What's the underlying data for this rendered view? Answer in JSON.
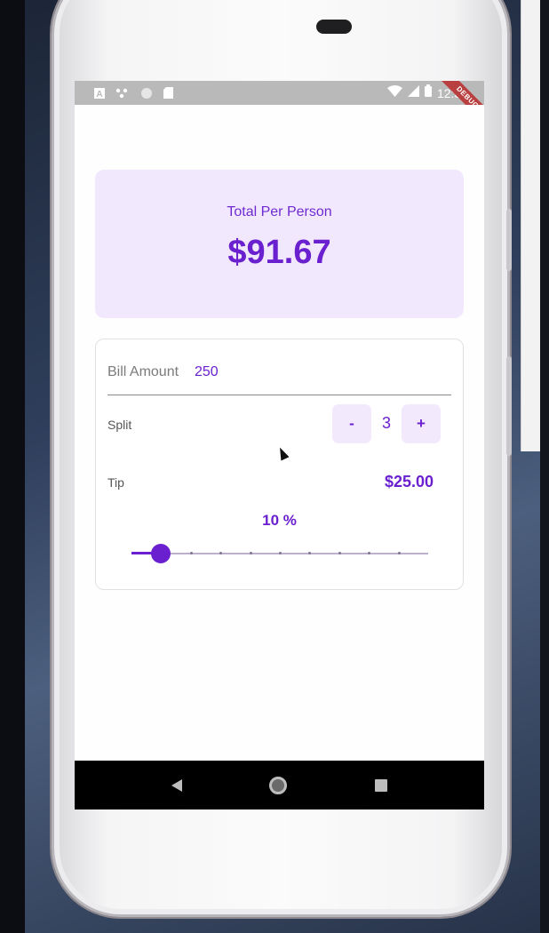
{
  "app": {
    "total_label": "Total Per Person",
    "total_value": "$91.67",
    "bill_label": "Bill Amount",
    "bill_value": "250",
    "split_label": "Split",
    "split_minus": "-",
    "split_count": "3",
    "split_plus": "+",
    "tip_label": "Tip",
    "tip_amount": "$25.00",
    "tip_percent": "10 %",
    "tip_slider_value": 10,
    "tip_slider_min": 0,
    "tip_slider_max": 100,
    "tip_slider_divisions": 10
  },
  "status_bar": {
    "time": "12:34",
    "left_icons": [
      "a-notification-icon",
      "network-dots-icon",
      "circle-icon",
      "sd-card-icon"
    ],
    "right_icons": [
      "wifi-icon",
      "signal-icon",
      "battery-icon"
    ]
  },
  "debug_banner": "DEBUG",
  "colors": {
    "accent": "#6a20cf",
    "card_background": "#f2e8fd",
    "status_bar": "#b9b9b9",
    "debug_ribbon": "#b94040"
  },
  "nav_bar": {
    "icons": [
      "back-icon",
      "home-icon",
      "recents-icon"
    ]
  }
}
